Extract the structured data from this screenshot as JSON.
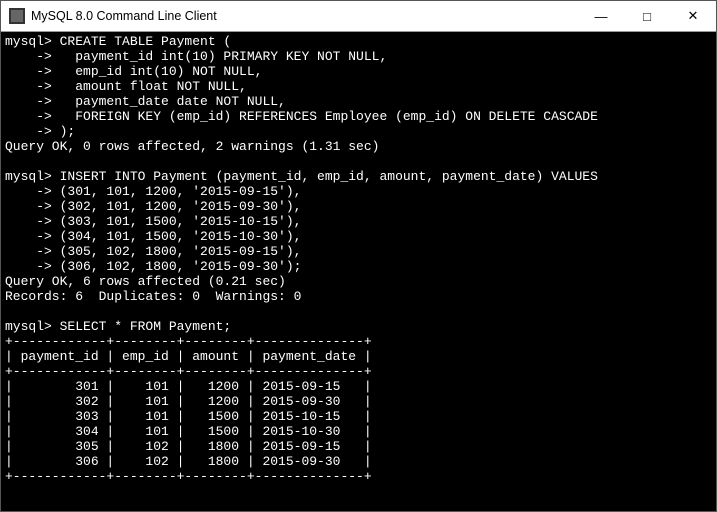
{
  "window": {
    "title": "MySQL 8.0 Command Line Client"
  },
  "titlebar_controls": {
    "minimize": "—",
    "maximize": "□",
    "close": "✕"
  },
  "session": {
    "prompt": "mysql>",
    "cont": "    ->",
    "create_table": {
      "l0": "mysql> CREATE TABLE Payment (",
      "l1": "    ->   payment_id int(10) PRIMARY KEY NOT NULL,",
      "l2": "    ->   emp_id int(10) NOT NULL,",
      "l3": "    ->   amount float NOT NULL,",
      "l4": "    ->   payment_date date NOT NULL,",
      "l5": "    ->   FOREIGN KEY (emp_id) REFERENCES Employee (emp_id) ON DELETE CASCADE",
      "l6": "    -> );",
      "result": "Query OK, 0 rows affected, 2 warnings (1.31 sec)"
    },
    "insert": {
      "l0": "mysql> INSERT INTO Payment (payment_id, emp_id, amount, payment_date) VALUES",
      "l1": "    -> (301, 101, 1200, '2015-09-15'),",
      "l2": "    -> (302, 101, 1200, '2015-09-30'),",
      "l3": "    -> (303, 101, 1500, '2015-10-15'),",
      "l4": "    -> (304, 101, 1500, '2015-10-30'),",
      "l5": "    -> (305, 102, 1800, '2015-09-15'),",
      "l6": "    -> (306, 102, 1800, '2015-09-30');",
      "result1": "Query OK, 6 rows affected (0.21 sec)",
      "result2": "Records: 6  Duplicates: 0  Warnings: 0"
    },
    "select": {
      "cmd": "mysql> SELECT * FROM Payment;",
      "border": "+------------+--------+--------+--------------+",
      "header": "| payment_id | emp_id | amount | payment_date |",
      "r1": "|        301 |    101 |   1200 | 2015-09-15   |",
      "r2": "|        302 |    101 |   1200 | 2015-09-30   |",
      "r3": "|        303 |    101 |   1500 | 2015-10-15   |",
      "r4": "|        304 |    101 |   1500 | 2015-10-30   |",
      "r5": "|        305 |    102 |   1800 | 2015-09-15   |",
      "r6": "|        306 |    102 |   1800 | 2015-09-30   |"
    }
  }
}
